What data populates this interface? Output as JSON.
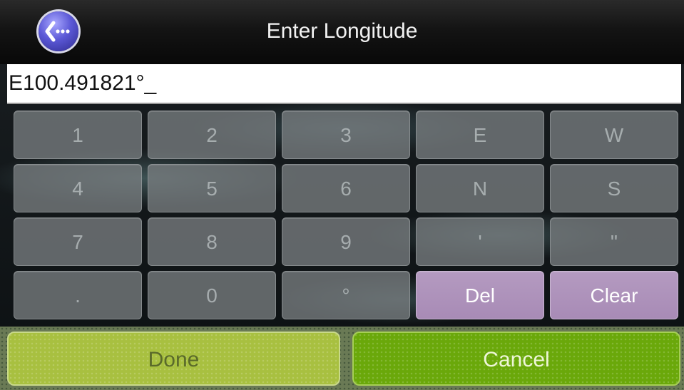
{
  "header": {
    "title": "Enter Longitude",
    "back_icon": "back-arrow-icon"
  },
  "entry": {
    "value": "E100.491821°_"
  },
  "keypad": {
    "rows": [
      [
        "1",
        "2",
        "3",
        "E",
        "W"
      ],
      [
        "4",
        "5",
        "6",
        "N",
        "S"
      ],
      [
        "7",
        "8",
        "9",
        "'",
        "\""
      ],
      [
        ".",
        "0",
        "°",
        "Del",
        "Clear"
      ]
    ]
  },
  "footer": {
    "done_label": "Done",
    "cancel_label": "Cancel"
  },
  "colors": {
    "key_disabled": "#7e8486",
    "key_action": "#ac91b9",
    "done": "#a8c040",
    "cancel": "#6aa80a",
    "back_button": "#5b58d6"
  }
}
